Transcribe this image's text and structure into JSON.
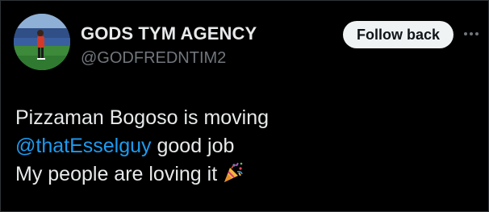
{
  "tweet": {
    "display_name": "GODS TYM AGENCY",
    "handle": "@GODFREDNTIM2",
    "follow_label": "Follow back",
    "more_icon": "ellipsis-icon",
    "lines": [
      {
        "text": "Pizzaman Bogoso is moving"
      },
      {
        "mention": "@thatEsselguy",
        "text": " good job"
      },
      {
        "text": "My people are loving it",
        "emoji": "party-popper-icon"
      }
    ]
  },
  "colors": {
    "background": "#000000",
    "text": "#e7e9ea",
    "secondary": "#71767b",
    "link": "#1d9bf0",
    "button_bg": "#eff3f4"
  }
}
